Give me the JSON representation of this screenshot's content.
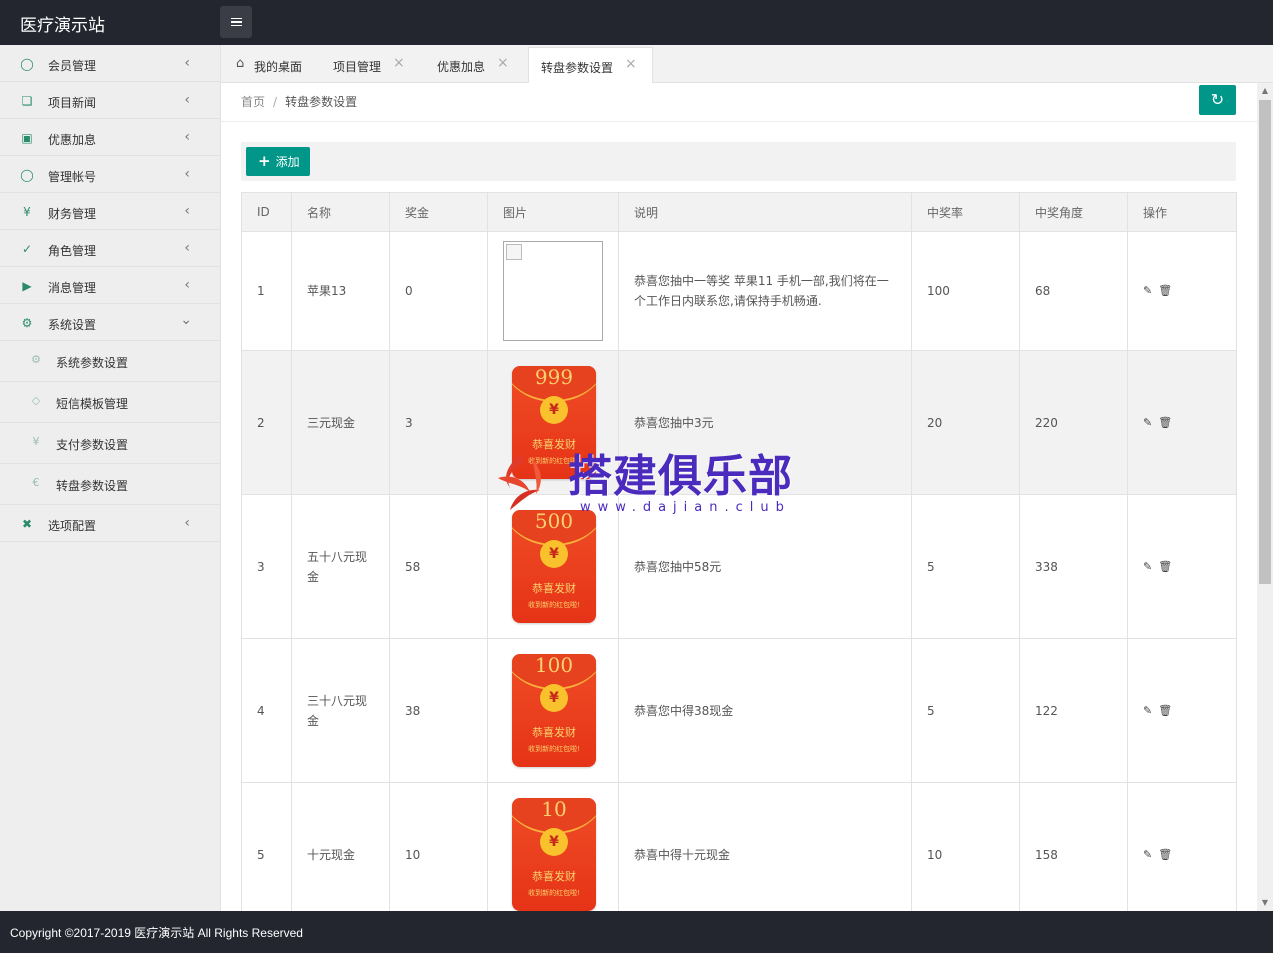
{
  "app": {
    "brand": "医疗演示站"
  },
  "sidebar": {
    "items": [
      {
        "label": "会员管理",
        "icon": "user-icon"
      },
      {
        "label": "项目新闻",
        "icon": "book-icon"
      },
      {
        "label": "优惠加息",
        "icon": "image-icon"
      },
      {
        "label": "管理帐号",
        "icon": "users-icon"
      },
      {
        "label": "财务管理",
        "icon": "yen-icon"
      },
      {
        "label": "角色管理",
        "icon": "shield-icon"
      },
      {
        "label": "消息管理",
        "icon": "speaker-icon"
      },
      {
        "label": "系统设置",
        "icon": "gear-icon",
        "expanded": true
      }
    ],
    "sub_items": [
      {
        "label": "系统参数设置",
        "icon": "gear-icon"
      },
      {
        "label": "短信模板管理",
        "icon": "tag-icon"
      },
      {
        "label": "支付参数设置",
        "icon": "yen-icon"
      },
      {
        "label": "转盘参数设置",
        "icon": "rmb-icon"
      }
    ],
    "last_item": {
      "label": "选项配置",
      "icon": "tools-icon"
    }
  },
  "tabs": [
    {
      "label": "我的桌面",
      "closable": false,
      "active": false
    },
    {
      "label": "项目管理",
      "closable": true,
      "active": false
    },
    {
      "label": "优惠加息",
      "closable": true,
      "active": false
    },
    {
      "label": "转盘参数设置",
      "closable": true,
      "active": true
    }
  ],
  "breadcrumb": {
    "home": "首页",
    "sep": "/",
    "current": "转盘参数设置"
  },
  "toolbar": {
    "add_label": "添加"
  },
  "table": {
    "headers": [
      "ID",
      "名称",
      "奖金",
      "图片",
      "说明",
      "中奖率",
      "中奖角度",
      "操作"
    ],
    "rows": [
      {
        "id": "1",
        "name": "苹果13",
        "bonus": "0",
        "image": null,
        "desc": "恭喜您抽中一等奖 苹果11 手机一部,我们将在一个工作日内联系您,请保持手机畅通.",
        "rate": "100",
        "angle": "68"
      },
      {
        "id": "2",
        "name": "三元现金",
        "bonus": "3",
        "image": {
          "amount": "999",
          "title": "恭喜发财",
          "sub": "收到新的红包啦!"
        },
        "desc": "恭喜您抽中3元",
        "rate": "20",
        "angle": "220"
      },
      {
        "id": "3",
        "name": "五十八元现金",
        "bonus": "58",
        "image": {
          "amount": "500",
          "title": "恭喜发财",
          "sub": "收到新的红包啦!"
        },
        "desc": "恭喜您抽中58元",
        "rate": "5",
        "angle": "338"
      },
      {
        "id": "4",
        "name": "三十八元现金",
        "bonus": "38",
        "image": {
          "amount": "100",
          "title": "恭喜发财",
          "sub": "收到新的红包啦!"
        },
        "desc": "恭喜您中得38现金",
        "rate": "5",
        "angle": "122"
      },
      {
        "id": "5",
        "name": "十元现金",
        "bonus": "10",
        "image": {
          "amount": "10",
          "title": "恭喜发财",
          "sub": "收到新的红包啦!"
        },
        "desc": "恭喜中得十元现金",
        "rate": "10",
        "angle": "158"
      }
    ]
  },
  "watermark": {
    "text": "搭建俱乐部",
    "url": "www.dajian.club"
  },
  "footer": {
    "copyright": "Copyright ©2017-2019 医疗演示站 All Rights Reserved"
  },
  "colors": {
    "accent": "#009688",
    "topbar": "#23262e",
    "sidebar_icon": "#2a8b6a"
  }
}
